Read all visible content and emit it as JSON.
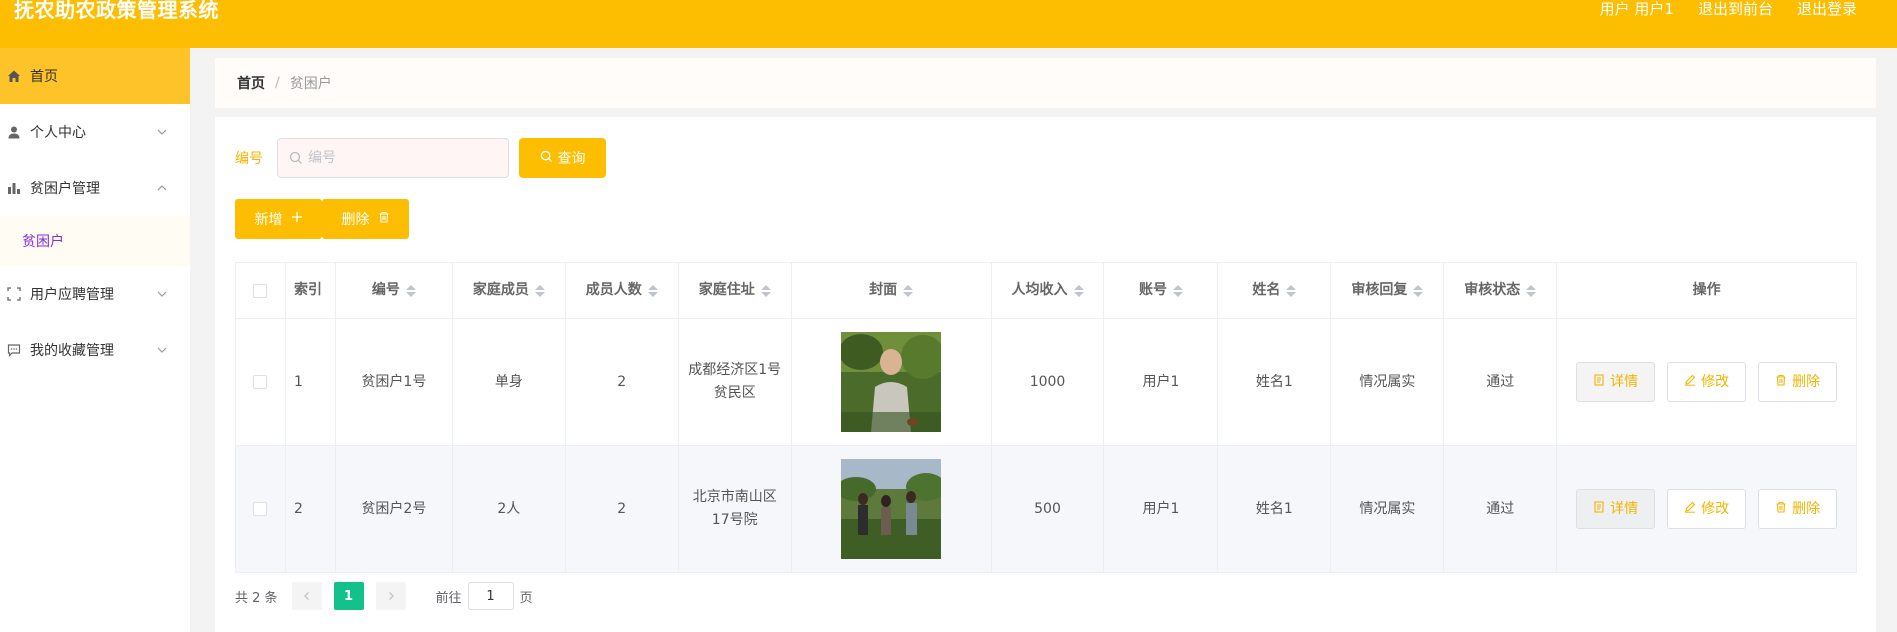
{
  "header": {
    "title": "抚农助农政策管理系统",
    "user_label": "用户 用户1",
    "to_front": "退出到前台",
    "logout": "退出登录"
  },
  "sidebar": {
    "items": [
      {
        "label": "首页",
        "icon": "home-icon"
      },
      {
        "label": "个人中心",
        "icon": "user-icon"
      },
      {
        "label": "贫困户管理",
        "icon": "bar-chart-icon"
      },
      {
        "label": "贫困户",
        "icon": ""
      },
      {
        "label": "用户应聘管理",
        "icon": "scan-icon"
      },
      {
        "label": "我的收藏管理",
        "icon": "chat-icon"
      }
    ]
  },
  "breadcrumb": {
    "home": "首页",
    "separator": "/",
    "current": "贫困户"
  },
  "search": {
    "label": "编号",
    "placeholder": "编号",
    "button": "查询"
  },
  "actions": {
    "add": "新增",
    "delete": "删除"
  },
  "table": {
    "headers": [
      "索引",
      "编号",
      "家庭成员",
      "成员人数",
      "家庭住址",
      "封面",
      "人均收入",
      "账号",
      "姓名",
      "审核回复",
      "审核状态",
      "操作"
    ],
    "rows": [
      {
        "index": "1",
        "number": "贫困户1号",
        "members": "单身",
        "count": "2",
        "address": "成都经济区1号贫民区",
        "income": "1000",
        "account": "用户1",
        "name": "姓名1",
        "reply": "情况属实",
        "status": "通过"
      },
      {
        "index": "2",
        "number": "贫困户2号",
        "members": "2人",
        "count": "2",
        "address": "北京市南山区17号院",
        "income": "500",
        "account": "用户1",
        "name": "姓名1",
        "reply": "情况属实",
        "status": "通过"
      }
    ],
    "op_labels": {
      "detail": "详情",
      "edit": "修改",
      "delete": "删除"
    }
  },
  "pagination": {
    "total": "共 2 条",
    "current": "1",
    "goto_prefix": "前往",
    "goto_value": "1",
    "goto_suffix": "页"
  },
  "colors": {
    "brand": "#fdbd01",
    "active_page": "#13c28a",
    "submenu_text": "#8a2be2"
  }
}
